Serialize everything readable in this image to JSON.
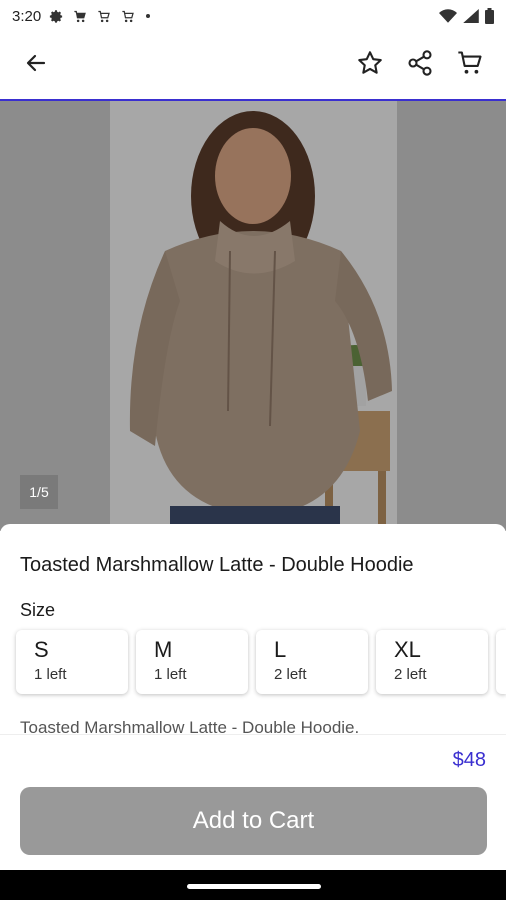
{
  "status_bar": {
    "time": "3:20",
    "icons": [
      "gear-icon",
      "cart-icon",
      "cart-icon",
      "cart-icon",
      "dot-icon"
    ],
    "right_icons": [
      "wifi-icon",
      "signal-icon",
      "battery-icon"
    ]
  },
  "app_bar": {
    "back_icon": "arrow-left-icon",
    "actions": [
      "star-icon",
      "share-icon",
      "cart-icon"
    ]
  },
  "hero": {
    "counter": "1/5"
  },
  "product": {
    "title": "Toasted Marshmallow Latte - Double Hoodie",
    "size_label": "Size",
    "sizes": [
      {
        "name": "S",
        "left": "1 left"
      },
      {
        "name": "M",
        "left": "1 left"
      },
      {
        "name": "L",
        "left": "2 left"
      },
      {
        "name": "XL",
        "left": "2 left"
      }
    ],
    "description": "Toasted Marshmallow Latte - Double Hoodie.",
    "price": "$48",
    "add_to_cart": "Add to Cart"
  },
  "colors": {
    "accent": "#3a2fd0",
    "button_disabled": "#999999"
  }
}
